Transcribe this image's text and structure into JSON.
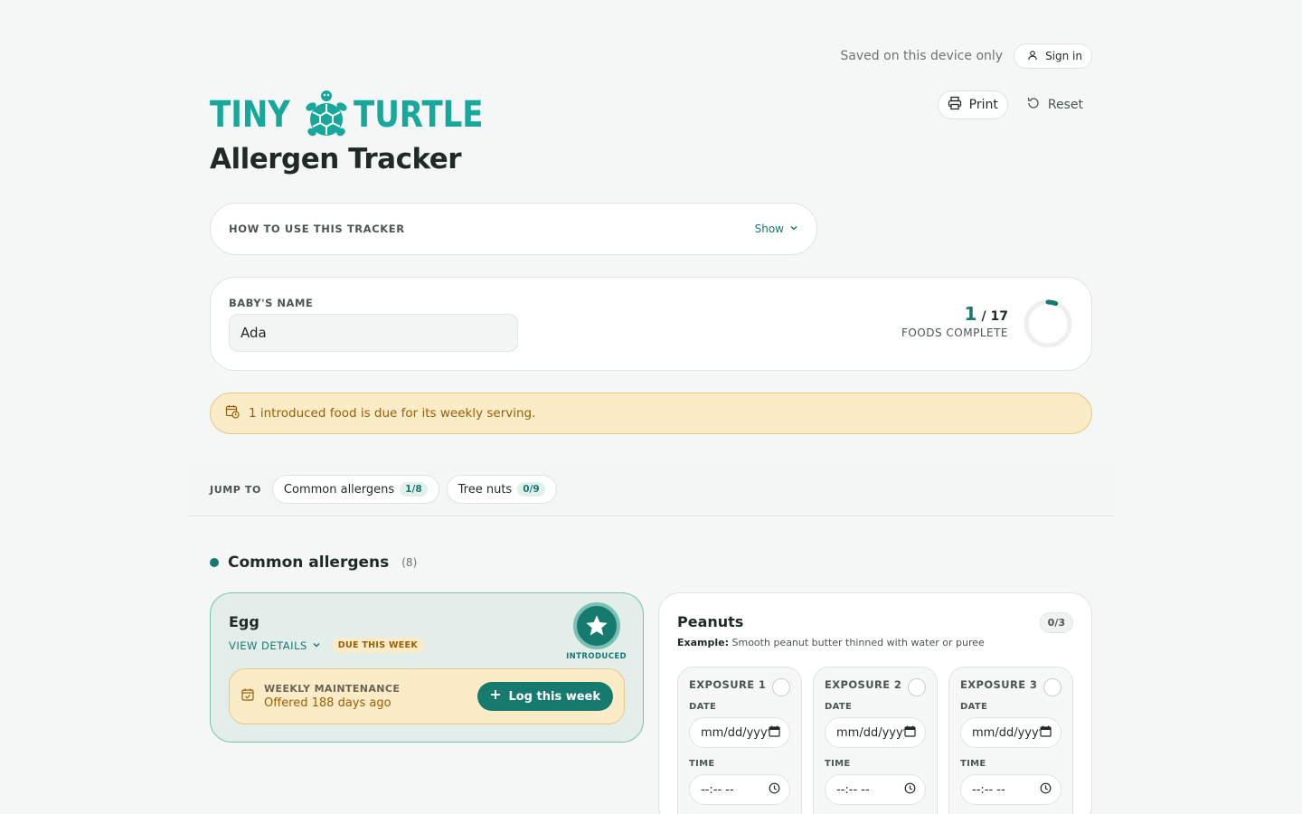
{
  "topbar": {
    "saved_text": "Saved on this device only",
    "signin_label": "Sign in"
  },
  "brand": {
    "logo_left": "TINY",
    "logo_right": "TURTLE",
    "title": "Allergen Tracker"
  },
  "actions": {
    "print_label": "Print",
    "reset_label": "Reset"
  },
  "howto": {
    "label": "HOW TO USE THIS TRACKER",
    "toggle_label": "Show"
  },
  "baby": {
    "label": "BABY'S NAME",
    "name_value": "Ada"
  },
  "progress": {
    "completed": "1",
    "total": "/ 17",
    "label": "FOODS COMPLETE",
    "fraction": 0.0588
  },
  "banner": {
    "text": "1 introduced food is due for its weekly serving."
  },
  "jump": {
    "label": "JUMP TO",
    "items": [
      {
        "label": "Common allergens",
        "count": "1/8"
      },
      {
        "label": "Tree nuts",
        "count": "0/9"
      }
    ]
  },
  "section": {
    "title": "Common allergens",
    "count": "(8)"
  },
  "egg": {
    "name": "Egg",
    "view_details": "VIEW DETAILS",
    "due_badge": "DUE THIS WEEK",
    "status": "INTRODUCED",
    "maintenance_label": "WEEKLY MAINTENANCE",
    "maintenance_value": "Offered 188 days ago",
    "log_button": "Log this week"
  },
  "peanuts": {
    "name": "Peanuts",
    "example_label": "Example:",
    "example_text": "Smooth peanut butter thinned with water or puree",
    "count": "0/3",
    "exposures": [
      {
        "title": "EXPOSURE 1",
        "date_label": "DATE",
        "date_placeholder": "mm/dd/yyyy",
        "time_label": "TIME",
        "time_placeholder": "--:-- --"
      },
      {
        "title": "EXPOSURE 2",
        "date_label": "DATE",
        "date_placeholder": "mm/dd/yyyy",
        "time_label": "TIME",
        "time_placeholder": "--:-- --"
      },
      {
        "title": "EXPOSURE 3",
        "date_label": "DATE",
        "date_placeholder": "mm/dd/yyyy",
        "time_label": "TIME",
        "time_placeholder": "--:-- --"
      }
    ]
  },
  "colors": {
    "accent": "#167a6f",
    "brand": "#17a79b",
    "warning_bg": "#fbecc8",
    "warning_text": "#9a5d08"
  }
}
